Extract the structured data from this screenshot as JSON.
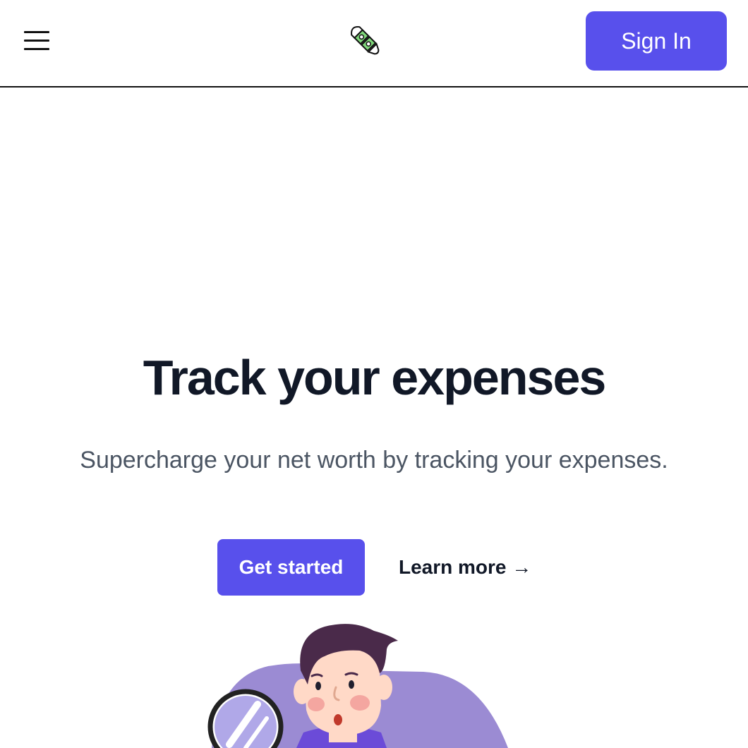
{
  "header": {
    "menu_icon": "hamburger-menu-icon",
    "logo_icon": "rocket-money-logo-icon",
    "logo_colors": {
      "bill": "#7fd67a",
      "outline": "#111111"
    },
    "sign_in_label": "Sign In"
  },
  "hero": {
    "title": "Track your expenses",
    "subtitle": "Supercharge your net worth by tracking your expenses.",
    "primary_cta": "Get started",
    "secondary_cta": "Learn more →"
  },
  "illustration": {
    "icon": "person-with-magnifying-glass-illustration"
  },
  "colors": {
    "accent": "#5850ec",
    "heading": "#111827",
    "body_text": "#4b5563",
    "illustration_blob": "#9b8bd3",
    "hair": "#4a2a4a",
    "skin": "#ffd9c7",
    "cheek": "#f4a6a0"
  }
}
